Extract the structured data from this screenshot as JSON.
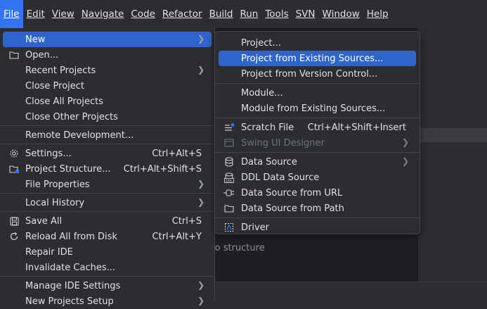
{
  "menubar": [
    {
      "label": "File",
      "active": true
    },
    {
      "label": "Edit"
    },
    {
      "label": "View"
    },
    {
      "label": "Navigate"
    },
    {
      "label": "Code"
    },
    {
      "label": "Refactor"
    },
    {
      "label": "Build"
    },
    {
      "label": "Run"
    },
    {
      "label": "Tools"
    },
    {
      "label": "SVN"
    },
    {
      "label": "Window"
    },
    {
      "label": "Help"
    }
  ],
  "file_menu": {
    "new": {
      "label": "New"
    },
    "open": {
      "label": "Open..."
    },
    "recent_projects": {
      "label": "Recent Projects"
    },
    "close_project": {
      "label": "Close Project"
    },
    "close_all_projects": {
      "label": "Close All Projects"
    },
    "close_other_projects": {
      "label": "Close Other Projects"
    },
    "remote_development": {
      "label": "Remote Development..."
    },
    "settings": {
      "label": "Settings...",
      "shortcut": "Ctrl+Alt+S"
    },
    "project_structure": {
      "label": "Project Structure...",
      "shortcut": "Ctrl+Alt+Shift+S"
    },
    "file_properties": {
      "label": "File Properties"
    },
    "local_history": {
      "label": "Local History"
    },
    "save_all": {
      "label": "Save All",
      "shortcut": "Ctrl+S"
    },
    "reload_all": {
      "label": "Reload All from Disk",
      "shortcut": "Ctrl+Alt+Y"
    },
    "repair_ide": {
      "label": "Repair IDE"
    },
    "invalidate_caches": {
      "label": "Invalidate Caches..."
    },
    "manage_ide_settings": {
      "label": "Manage IDE Settings"
    },
    "new_projects_setup": {
      "label": "New Projects Setup"
    }
  },
  "new_submenu": {
    "project": {
      "label": "Project..."
    },
    "project_existing": {
      "label": "Project from Existing Sources..."
    },
    "project_vcs": {
      "label": "Project from Version Control..."
    },
    "module": {
      "label": "Module..."
    },
    "module_existing": {
      "label": "Module from Existing Sources..."
    },
    "scratch_file": {
      "label": "Scratch File",
      "shortcut": "Ctrl+Alt+Shift+Insert"
    },
    "swing_ui_designer": {
      "label": "Swing UI Designer"
    },
    "data_source": {
      "label": "Data Source"
    },
    "ddl_data_source": {
      "label": "DDL Data Source"
    },
    "data_source_url": {
      "label": "Data Source from URL"
    },
    "data_source_path": {
      "label": "Data Source from Path"
    },
    "driver": {
      "label": "Driver"
    }
  },
  "background": {
    "no_structure_text": "lo structure"
  },
  "colors": {
    "accent": "#2f65ca",
    "menubar_active": "#3574f0",
    "background": "#2b2d30",
    "editor": "#1e1f22"
  }
}
